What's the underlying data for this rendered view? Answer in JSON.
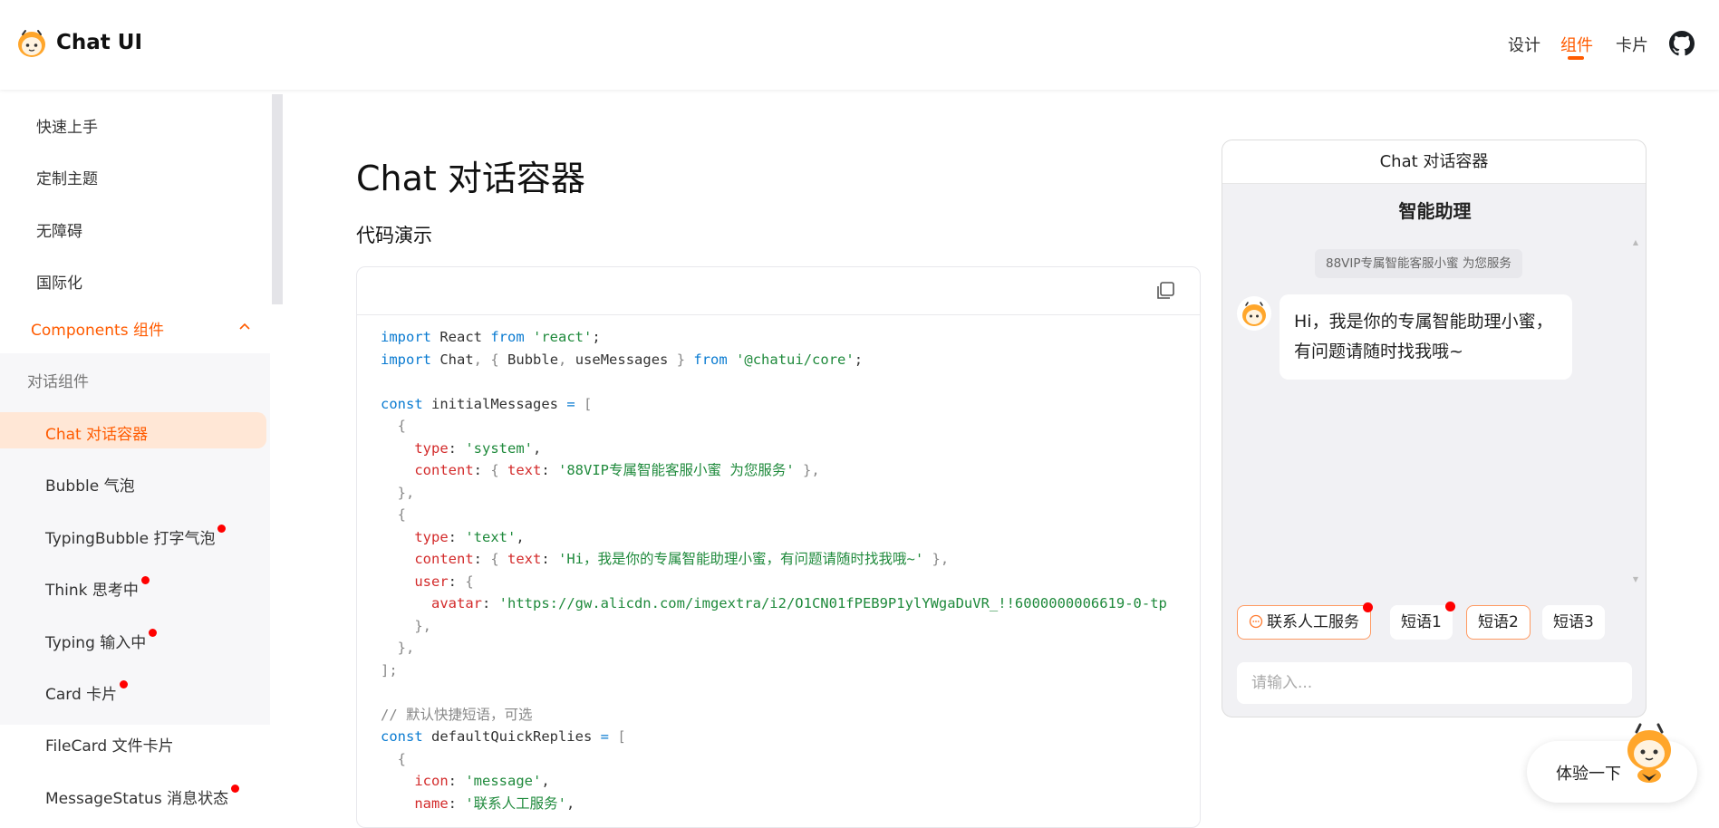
{
  "header": {
    "brand": "Chat UI",
    "nav": [
      "设计",
      "组件",
      "卡片"
    ],
    "active_nav": "组件",
    "accent": "#ff5b00"
  },
  "sidebar": {
    "top_items": [
      "快速上手",
      "定制主题",
      "无障碍",
      "国际化"
    ],
    "group": "Components 组件",
    "subgroup": "对话组件",
    "children": [
      {
        "label": "Chat 对话容器",
        "active": true,
        "dot": false
      },
      {
        "label": "Bubble 气泡",
        "active": false,
        "dot": false
      },
      {
        "label": "TypingBubble 打字气泡",
        "active": false,
        "dot": true
      },
      {
        "label": "Think 思考中",
        "active": false,
        "dot": true
      },
      {
        "label": "Typing 输入中",
        "active": false,
        "dot": true
      },
      {
        "label": "Card 卡片",
        "active": false,
        "dot": true
      },
      {
        "label": "FileCard 文件卡片",
        "active": false,
        "dot": false
      },
      {
        "label": "MessageStatus 消息状态",
        "active": false,
        "dot": true
      }
    ]
  },
  "main": {
    "title": "Chat 对话容器",
    "section": "代码演示"
  },
  "demo": {
    "window_title": "Chat 对话容器",
    "assistant_name": "智能助理",
    "system_message": "88VIP专属智能客服小蜜 为您服务",
    "bubble_text": "Hi，我是你的专属智能助理小蜜，有问题请随时找我哦~",
    "quick_replies": [
      {
        "label": "联系人工服务",
        "icon": "message-icon",
        "dot": true,
        "highlight": true
      },
      {
        "label": "短语1",
        "dot": true,
        "highlight": false
      },
      {
        "label": "短语2",
        "dot": false,
        "highlight": true
      },
      {
        "label": "短语3",
        "dot": false,
        "highlight": false
      }
    ],
    "input_placeholder": "请输入..."
  },
  "try_button": "体验一下"
}
